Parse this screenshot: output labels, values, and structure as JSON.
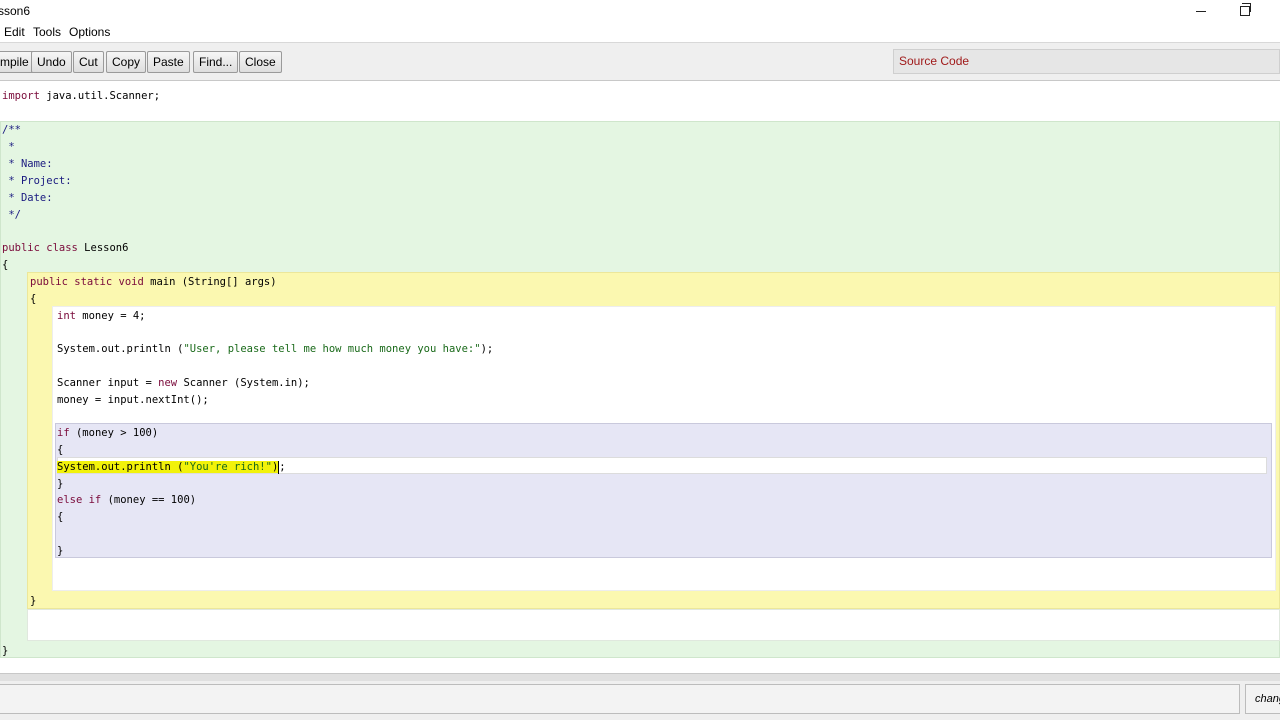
{
  "window": {
    "title": "sson6",
    "minimize_icon": "minimize-icon",
    "restore_icon": "restore-icon"
  },
  "menu": {
    "items": [
      "Edit",
      "Tools",
      "Options"
    ]
  },
  "toolbar": {
    "buttons": [
      "mpile",
      "Undo",
      "Cut",
      "Copy",
      "Paste",
      "Find...",
      "Close"
    ],
    "view_selector": "Source Code"
  },
  "code": {
    "lines": [
      "import java.util.Scanner;",
      "/**",
      " *",
      " * Name:",
      " * Project:",
      " * Date:",
      " */",
      "public class Lesson6",
      "{",
      "public static void main (String[] args)",
      "{",
      "int money = 4;",
      "System.out.println (\"User, please tell me how much money you have:\");",
      "Scanner input = new Scanner (System.in);",
      "money = input.nextInt();",
      "if (money > 100)",
      "{",
      "System.out.println (\"You're rich!\");",
      "}",
      "else if (money == 100)",
      "{",
      "}",
      "}",
      "}"
    ]
  },
  "statusbar": {
    "message": "",
    "right_text": "changed"
  },
  "colors": {
    "class_scope": "#e4f6e2",
    "method_scope": "#fbf8b0",
    "if_scope": "#e6e6f5",
    "selection": "#f2f20a",
    "keyword": "#7a0a3a",
    "string": "#1a6a1a"
  }
}
